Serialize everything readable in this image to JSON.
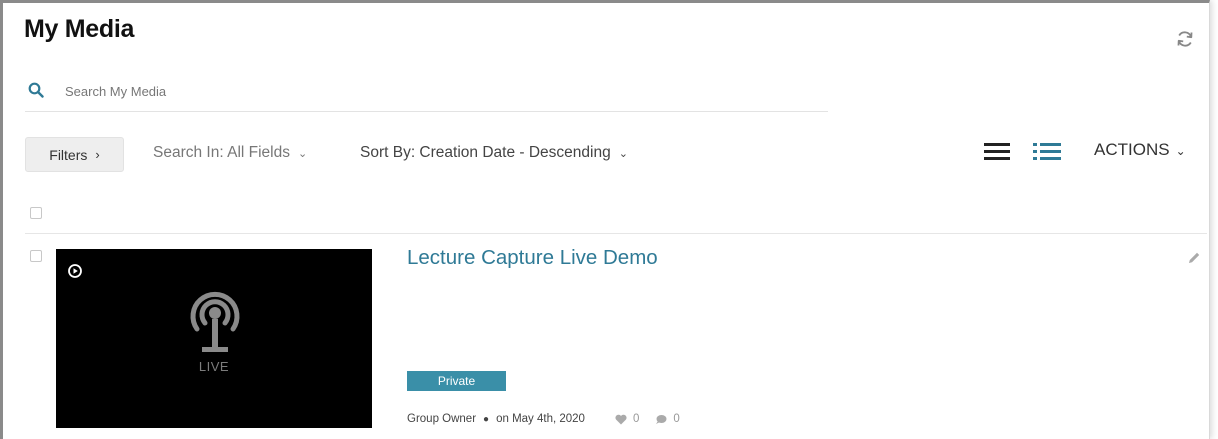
{
  "header": {
    "title": "My Media"
  },
  "search": {
    "placeholder": "Search My Media",
    "value": ""
  },
  "toolbar": {
    "filters_label": "Filters",
    "search_in_label": "Search In: All Fields",
    "sort_by_label": "Sort By: Creation Date - Descending",
    "actions_label": "ACTIONS"
  },
  "media_list": [
    {
      "title": "Lecture Capture Live Demo",
      "thumbnail_label": "LIVE",
      "privacy": "Private",
      "owner": "Group Owner",
      "date": "on May 4th, 2020",
      "likes": "0",
      "comments": "0"
    }
  ],
  "icons": {
    "refresh": "refresh-icon",
    "search": "search-icon",
    "view_list": "list-view-icon",
    "view_detailed": "detailed-view-icon",
    "play": "play-icon",
    "live": "live-broadcast-icon",
    "edit": "pencil-icon",
    "like": "heart-icon",
    "comment": "comment-icon"
  },
  "colors": {
    "accent": "#2f7a96",
    "badge": "#3a8fa8",
    "title": "#111111",
    "muted": "#777777"
  }
}
